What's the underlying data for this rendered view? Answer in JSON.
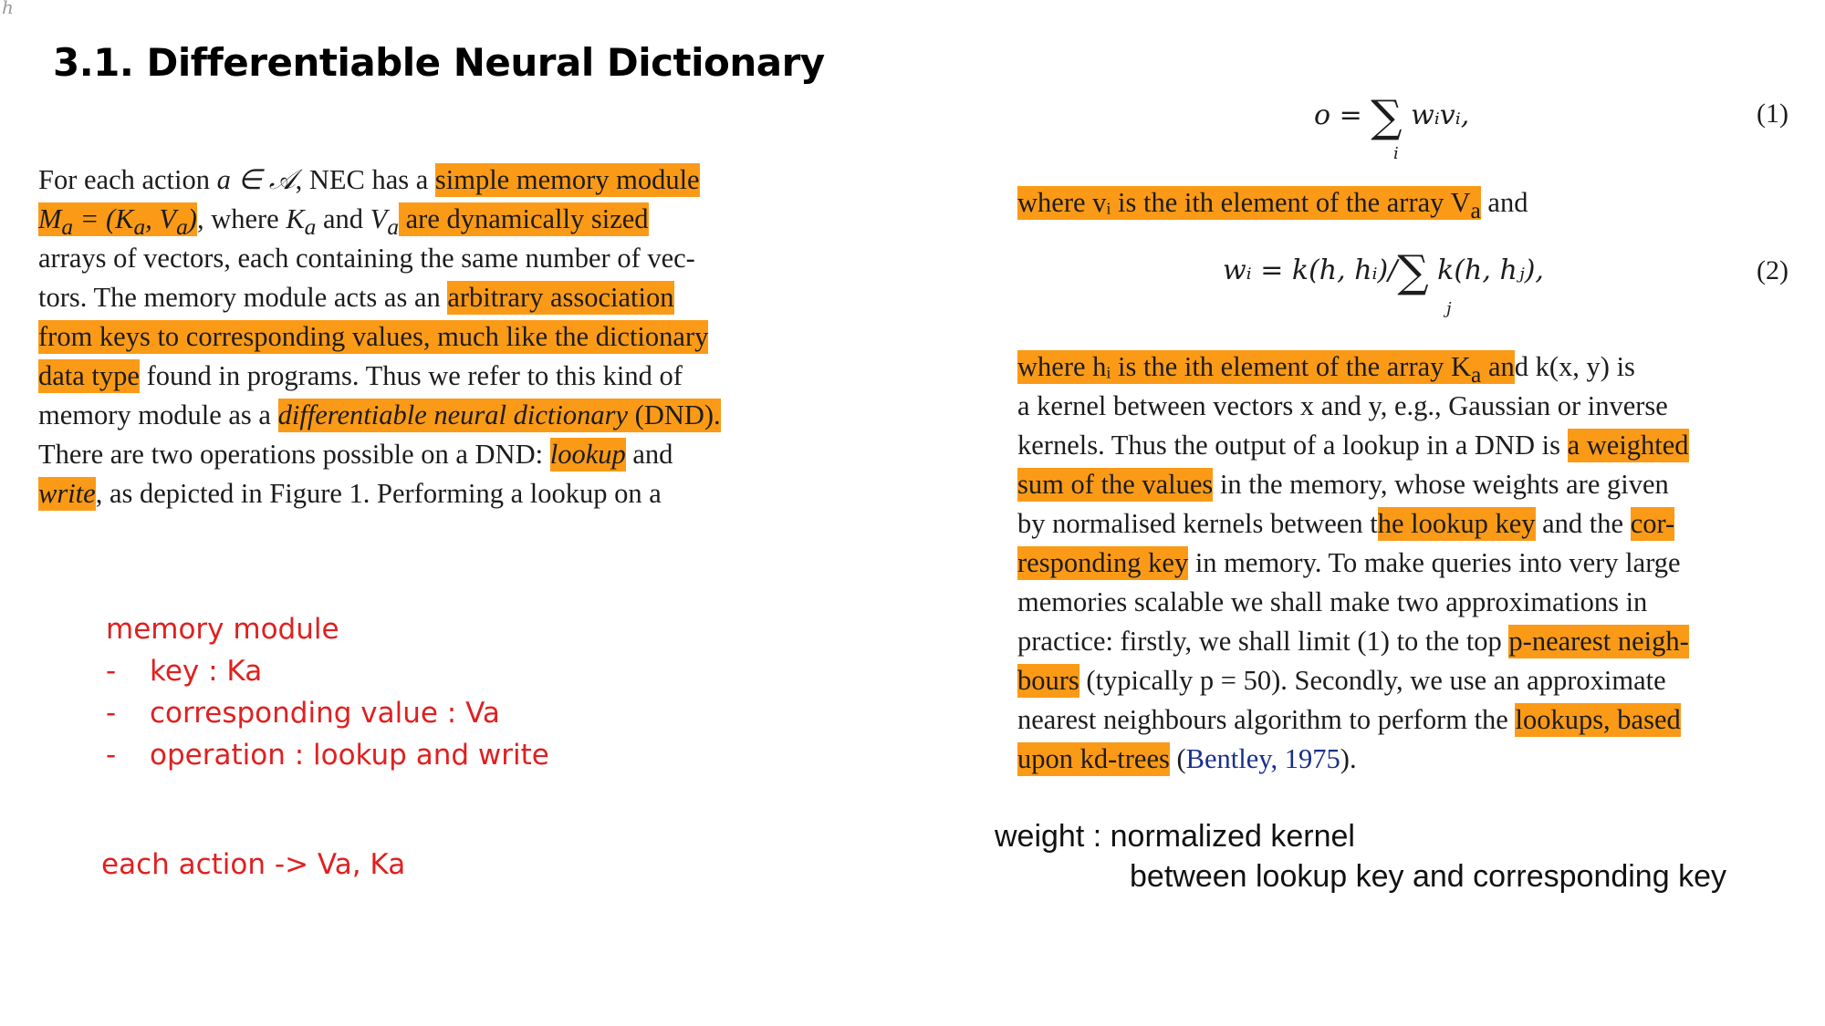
{
  "corner_mark": "h",
  "title": "3.1. Differentiable Neural Dictionary",
  "left_excerpt": {
    "l1_a": "For each action ",
    "l1_b": "a ∈ 𝒜",
    "l1_c": ", NEC has a ",
    "l1_hl": "simple memory module",
    "l2_hl": "M",
    "l2_hl_sub": "a",
    "l2_hl_b": " = (K",
    "l2_hl_sub2": "a",
    "l2_hl_c": ", V",
    "l2_hl_sub3": "a",
    "l2_hl_d": ")",
    "l2_a": ", where ",
    "l2_k": "K",
    "l2_ksub": "a",
    "l2_b": " and ",
    "l2_v": "V",
    "l2_vsub": "a",
    "l2_hl2": " are dynamically sized",
    "l3": "arrays of vectors, each containing the same number of vec-",
    "l4_a": "tors. The memory module acts as an ",
    "l4_hl": "arbitrary association",
    "l5_hl": "from keys to corresponding values, much like the dictionary",
    "l6_hl": "data type",
    "l6_a": " found in programs. Thus we refer to this kind of",
    "l7_a": "memory module as a ",
    "l7_hl": "differentiable neural dictionary",
    "l7_hl2": " (DND).",
    "l8_a": "There are two operations possible on a DND: ",
    "l8_hl": "lookup",
    "l8_b": " and",
    "l9_hl": "write",
    "l9_a": ", as depicted in Figure 1.  Performing a lookup on a"
  },
  "right_excerpt": {
    "eq1": "o = ",
    "eq1_sigma": "∑",
    "eq1_sub": "i",
    "eq1_rest": " wᵢvᵢ,",
    "eq1_num": "(1)",
    "w1_hl": "where vᵢ is the ith element of the array V",
    "w1_hl_sub": "a",
    "w1_a": " and",
    "eq2": "wᵢ = k(h, hᵢ)/",
    "eq2_sigma": "∑",
    "eq2_sub": "j",
    "eq2_rest": " k(h, hⱼ),",
    "eq2_num": "(2)",
    "p1_hl": "where hᵢ is the ith element of the array K",
    "p1_hl_sub": "a",
    "p1_hl_b": " an",
    "p1_a": "d k(x, y) is",
    "p2": "a kernel between vectors x and y, e.g., Gaussian or inverse",
    "p3_a": "kernels. Thus the output of a lookup in a DND is ",
    "p3_hl": "a weighted",
    "p4_hl": "sum of the values",
    "p4_a": " in the memory, whose weights are given",
    "p5_a": "by normalised kernels between t",
    "p5_hl": "he lookup key",
    "p5_b": " and the ",
    "p5_hl2": "cor-",
    "p6_hl": "responding key",
    "p6_a": " in memory. To make queries into very large",
    "p7": "memories scalable we shall make two approximations in",
    "p8_a": "practice: firstly, we shall limit (1) to the top ",
    "p8_hl": "p-nearest neigh-",
    "p9_hl": "bours",
    "p9_a": " (typically p = 50). Secondly, we use an approximate",
    "p10_a": "nearest neighbours algorithm to perform the ",
    "p10_hl": "lookups, based",
    "p11_hl": "upon kd-trees",
    "p11_a": " (",
    "p11_cite": "Bentley, 1975",
    "p11_b": ")."
  },
  "red_notes": {
    "heading": "memory module",
    "bullets": [
      "key : Ka",
      "corresponding  value : Va",
      "operation  : lookup  and write"
    ],
    "dash": "-",
    "action": "each action -> Va, Ka"
  },
  "black_note": {
    "line1": "weight : normalized kernel",
    "line2": "between lookup key and corresponding key"
  },
  "colors": {
    "highlight": "#fb9a17",
    "note_red": "#e02020",
    "citation": "#1a2f8a"
  }
}
